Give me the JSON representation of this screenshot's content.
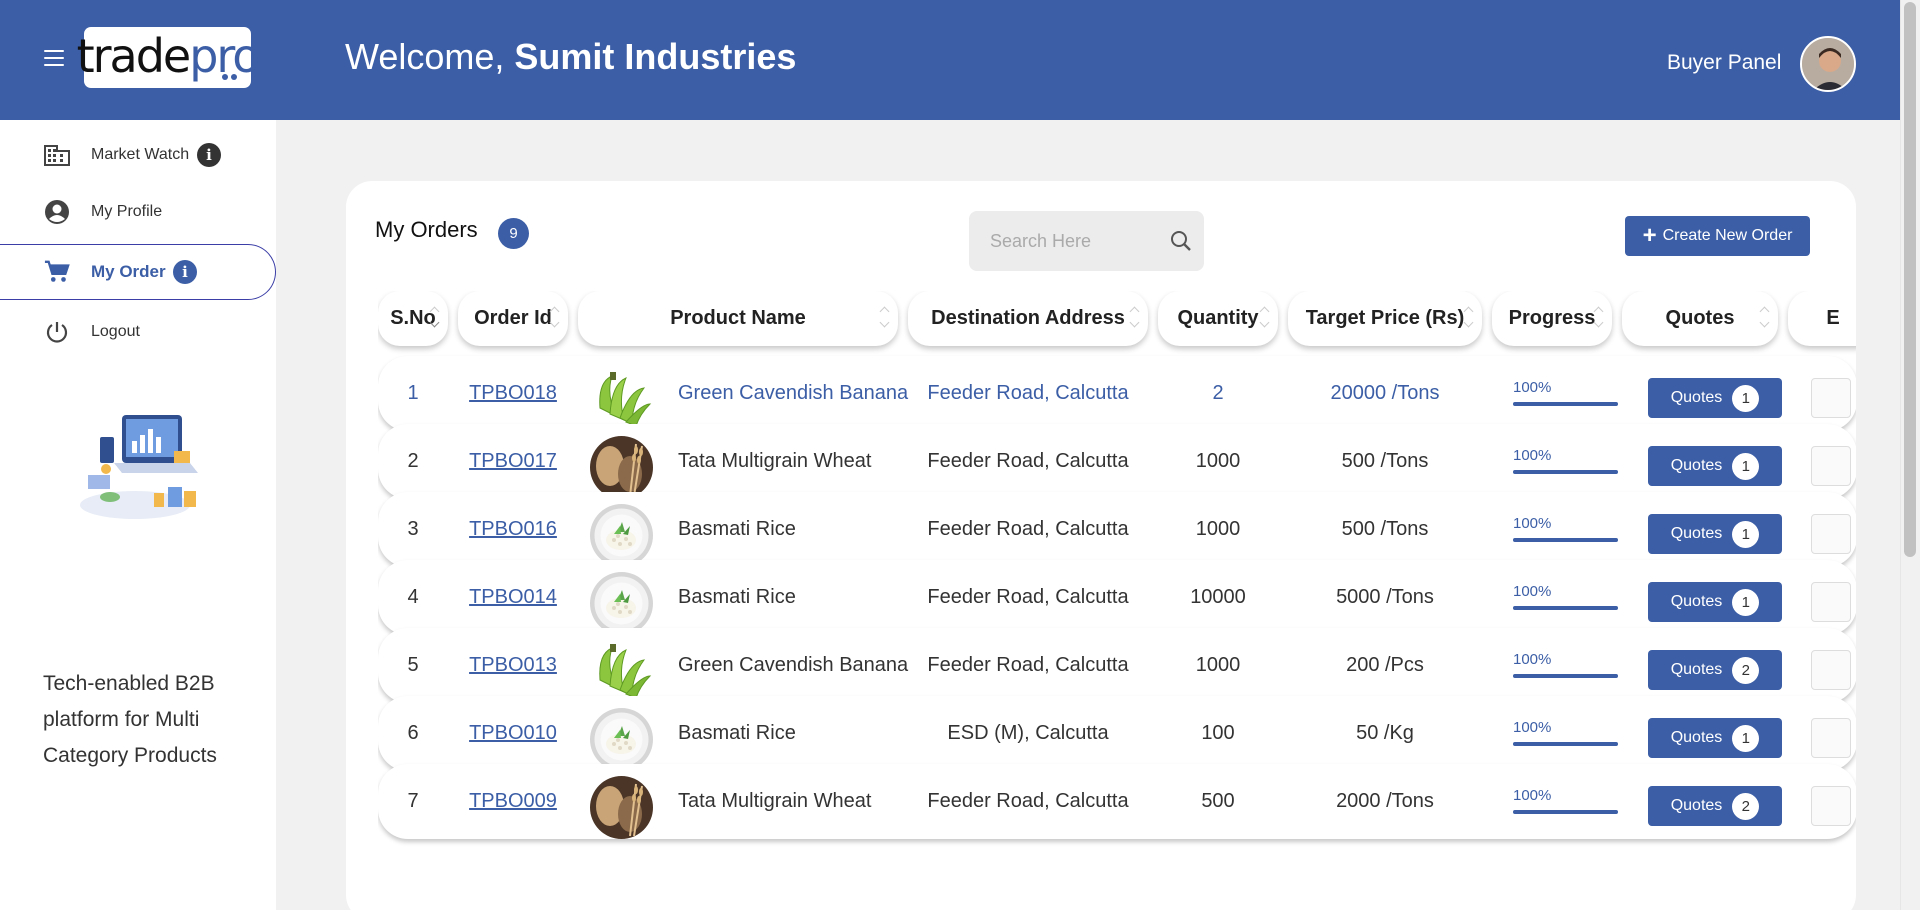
{
  "header": {
    "brand_trade": "trade",
    "brand_pro": "pro",
    "welcome_prefix": "Welcome,",
    "company_name": "Sumit Industries",
    "panel_label": "Buyer Panel",
    "color": "#3b5ea6"
  },
  "sidebar": {
    "items": [
      {
        "label": "Market Watch",
        "icon": "building-icon",
        "has_info": true,
        "info_color": "#333333"
      },
      {
        "label": "My Profile",
        "icon": "account-circle-icon",
        "has_info": false
      },
      {
        "label": "My Order",
        "icon": "cart-icon",
        "has_info": true,
        "info_color": "#3b5ea6",
        "active": true
      },
      {
        "label": "Logout",
        "icon": "power-icon",
        "has_info": false
      }
    ],
    "tagline": "Tech-enabled B2B platform for Multi Category Products"
  },
  "orders": {
    "title": "My Orders",
    "count": "9",
    "search_placeholder": "Search Here",
    "create_label": "Create New Order",
    "columns": [
      "S.No",
      "Order Id",
      "Product Name",
      "Destination Address",
      "Quantity",
      "Target Price (Rs)",
      "Progress",
      "Quotes",
      "E"
    ],
    "quotes_label": "Quotes",
    "rows": [
      {
        "sno": "1",
        "order_id": "TPBO018",
        "product": "Green Cavendish Banana",
        "image": "banana",
        "address": "Feeder Road, Calcutta",
        "quantity": "2",
        "price": "20000 /Tons",
        "progress": "100%",
        "progress_value": 1.0,
        "quotes": "1",
        "highlight": true
      },
      {
        "sno": "2",
        "order_id": "TPBO017",
        "product": "Tata Multigrain Wheat",
        "image": "wheat",
        "address": "Feeder Road, Calcutta",
        "quantity": "1000",
        "price": "500 /Tons",
        "progress": "100%",
        "progress_value": 1.0,
        "quotes": "1",
        "highlight": false
      },
      {
        "sno": "3",
        "order_id": "TPBO016",
        "product": "Basmati Rice",
        "image": "rice",
        "address": "Feeder Road, Calcutta",
        "quantity": "1000",
        "price": "500 /Tons",
        "progress": "100%",
        "progress_value": 1.0,
        "quotes": "1",
        "highlight": false
      },
      {
        "sno": "4",
        "order_id": "TPBO014",
        "product": "Basmati Rice",
        "image": "rice",
        "address": "Feeder Road, Calcutta",
        "quantity": "10000",
        "price": "5000 /Tons",
        "progress": "100%",
        "progress_value": 1.0,
        "quotes": "1",
        "highlight": false
      },
      {
        "sno": "5",
        "order_id": "TPBO013",
        "product": "Green Cavendish Banana",
        "image": "banana",
        "address": "Feeder Road, Calcutta",
        "quantity": "1000",
        "price": "200 /Pcs",
        "progress": "100%",
        "progress_value": 1.0,
        "quotes": "2",
        "highlight": false
      },
      {
        "sno": "6",
        "order_id": "TPBO010",
        "product": "Basmati Rice",
        "image": "rice",
        "address": "ESD (M), Calcutta",
        "quantity": "100",
        "price": "50 /Kg",
        "progress": "100%",
        "progress_value": 1.0,
        "quotes": "1",
        "highlight": false
      },
      {
        "sno": "7",
        "order_id": "TPBO009",
        "product": "Tata Multigrain Wheat",
        "image": "wheat",
        "address": "Feeder Road, Calcutta",
        "quantity": "500",
        "price": "2000 /Tons",
        "progress": "100%",
        "progress_value": 1.0,
        "quotes": "2",
        "highlight": false
      }
    ]
  }
}
